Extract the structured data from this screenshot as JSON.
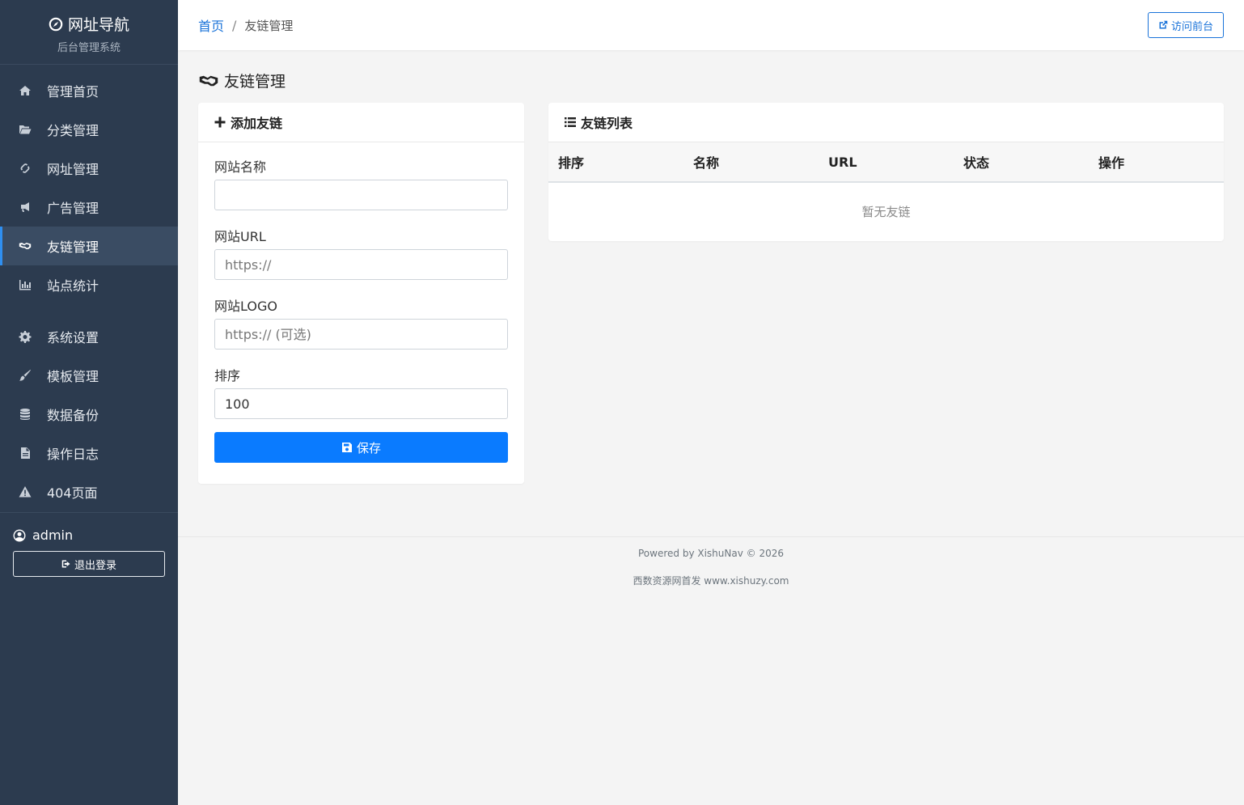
{
  "brand": {
    "title": "网址导航",
    "subtitle": "后台管理系统"
  },
  "nav": [
    {
      "label": "管理首页",
      "icon": "home-icon"
    },
    {
      "label": "分类管理",
      "icon": "folder-open-icon"
    },
    {
      "label": "网址管理",
      "icon": "link-icon"
    },
    {
      "label": "广告管理",
      "icon": "bullhorn-icon"
    },
    {
      "label": "友链管理",
      "icon": "handshake-icon",
      "active": true
    },
    {
      "label": "站点统计",
      "icon": "bar-chart-icon"
    },
    {
      "label": "系统设置",
      "icon": "gear-icon"
    },
    {
      "label": "模板管理",
      "icon": "brush-icon"
    },
    {
      "label": "数据备份",
      "icon": "database-icon"
    },
    {
      "label": "操作日志",
      "icon": "file-text-icon"
    },
    {
      "label": "404页面",
      "icon": "warning-icon"
    }
  ],
  "user": {
    "name": "admin",
    "logout_label": "退出登录"
  },
  "breadcrumb": {
    "home": "首页",
    "separator": "/",
    "current": "友链管理"
  },
  "topbar": {
    "visit_label": "访问前台"
  },
  "page": {
    "title": "友链管理"
  },
  "form": {
    "title": "添加友链",
    "fields": [
      {
        "label": "网站名称",
        "placeholder": "",
        "value": ""
      },
      {
        "label": "网站URL",
        "placeholder": "https://",
        "value": ""
      },
      {
        "label": "网站LOGO",
        "placeholder": "https:// (可选)",
        "value": ""
      },
      {
        "label": "排序",
        "placeholder": "",
        "value": "100"
      }
    ],
    "save_label": "保存"
  },
  "list": {
    "title": "友链列表",
    "columns": [
      "排序",
      "名称",
      "URL",
      "状态",
      "操作"
    ],
    "empty_text": "暂无友链"
  },
  "footer": {
    "line1": "Powered by XishuNav © 2026",
    "line2": "西数资源网首发 www.xishuzy.com"
  },
  "colors": {
    "sidebar_bg": "#2c3b4f",
    "accent": "#0a7bff",
    "link": "#1a73d9"
  }
}
